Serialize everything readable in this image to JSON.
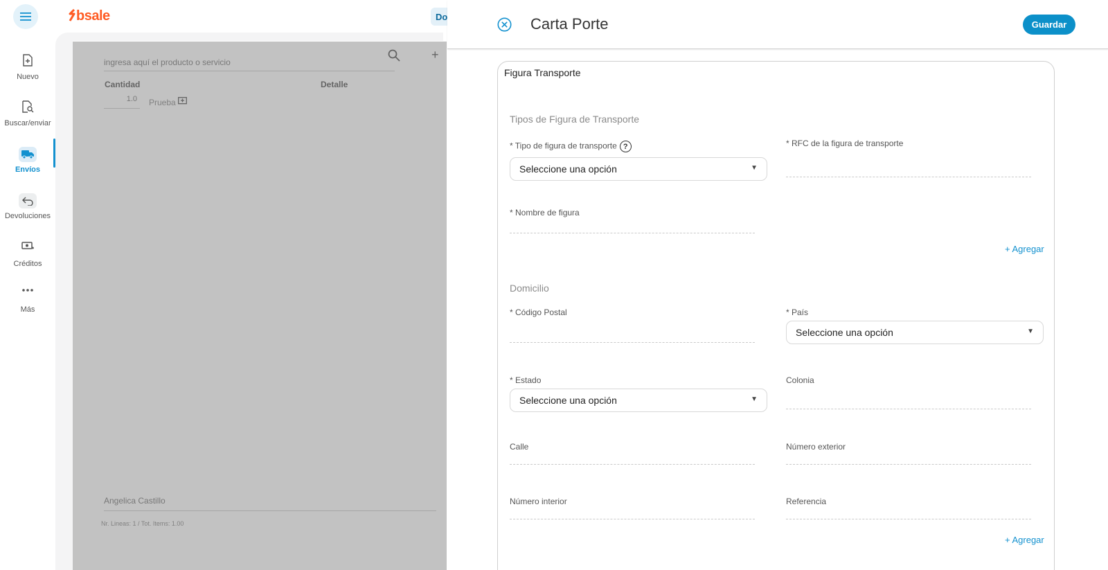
{
  "brand": {
    "logo_text": "bsale",
    "color": "#ff5b23"
  },
  "accent_color": "#1391cf",
  "topbar": {
    "doc_chip": "Do"
  },
  "nav": {
    "items": [
      {
        "label": "Nuevo",
        "icon": "file-plus-icon"
      },
      {
        "label": "Buscar/enviar",
        "icon": "file-search-icon"
      },
      {
        "label": "Envíos",
        "icon": "truck-icon",
        "active": true
      },
      {
        "label": "Devoluciones",
        "icon": "return-arrow-icon"
      },
      {
        "label": "Créditos",
        "icon": "cash-icon"
      },
      {
        "label": "Más",
        "icon": "more-dots-icon"
      }
    ]
  },
  "background": {
    "search_placeholder": "ingresa aquí el producto o servicio",
    "col_cantidad": "Cantidad",
    "col_detalle": "Detalle",
    "row_qty": "1.0",
    "row_detail": "Prueba",
    "seller": "Angelica Castillo",
    "totals": "Nr. Lineas: 1 / Tot. Items: 1.00"
  },
  "drawer": {
    "title": "Carta Porte",
    "save_label": "Guardar",
    "card_title": "Figura Transporte",
    "section_tipos": "Tipos de Figura de Transporte",
    "label_tipo_figura": "* Tipo de figura de transporte",
    "select_tipo_figura": "Seleccione una opción",
    "label_rfc": "* RFC de la figura de transporte",
    "label_nombre": "* Nombre de figura",
    "add_link_1": "+ Agregar",
    "section_domicilio": "Domicilio",
    "label_cp": "* Código Postal",
    "label_pais": "* País",
    "select_pais": "Seleccione una opción",
    "label_estado": "* Estado",
    "select_estado": "Seleccione una opción",
    "label_colonia": "Colonia",
    "label_calle": "Calle",
    "label_num_ext": "Número exterior",
    "label_num_int": "Número interior",
    "label_referencia": "Referencia",
    "add_link_2": "+ Agregar"
  }
}
